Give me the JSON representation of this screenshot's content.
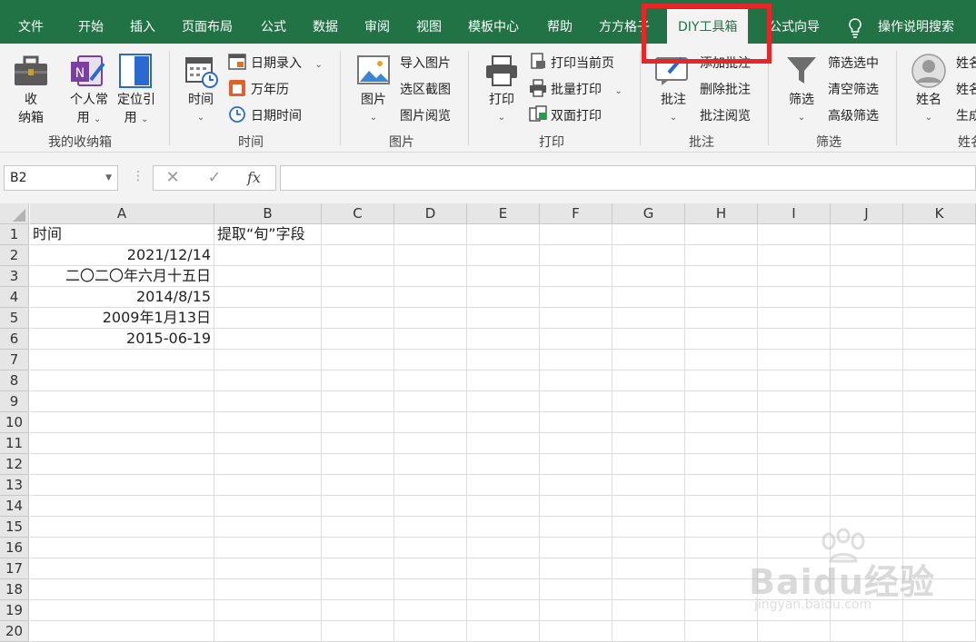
{
  "menubar": {
    "tabs": [
      "文件",
      "开始",
      "插入",
      "页面布局",
      "公式",
      "数据",
      "审阅",
      "视图",
      "模板中心",
      "帮助",
      "方方格子",
      "DIY工具箱",
      "公式向导",
      "操作说明搜索"
    ],
    "active_tab": "DIY工具箱"
  },
  "ribbon": {
    "collect": {
      "label_line1": "收",
      "label_line2": "纳箱",
      "personal_line1": "个人常",
      "personal_line2": "用",
      "locate_line1": "定位引",
      "locate_line2": "用",
      "group": "我的收纳箱"
    },
    "time": {
      "big": "时间",
      "date_entry": "日期录入",
      "calendar": "万年历",
      "datetime": "日期时间",
      "group": "时间"
    },
    "picture": {
      "big": "图片",
      "import": "导入图片",
      "screenshot": "选区截图",
      "browse": "图片阅览",
      "group": "图片"
    },
    "print": {
      "big": "打印",
      "current": "打印当前页",
      "batch": "批量打印",
      "duplex": "双面打印",
      "group": "打印"
    },
    "comment": {
      "big": "批注",
      "add": "添加批注",
      "delete": "删除批注",
      "browse": "批注阅览",
      "group": "批注"
    },
    "filter": {
      "big": "筛选",
      "select": "筛选选中",
      "clear": "清空筛选",
      "advanced": "高级筛选",
      "group": "筛选"
    },
    "name": {
      "big": "姓名",
      "item1": "姓名",
      "item2": "姓名",
      "item3": "生成",
      "group": "姓名"
    }
  },
  "formula_bar": {
    "name_box": "B2",
    "cancel": "✕",
    "enter": "✓",
    "fx": "fx",
    "value": ""
  },
  "sheet": {
    "columns": [
      "A",
      "B",
      "C",
      "D",
      "E",
      "F",
      "G",
      "H",
      "I",
      "J",
      "K"
    ],
    "rows": [
      "1",
      "2",
      "3",
      "4",
      "5",
      "6",
      "7",
      "8",
      "9",
      "10",
      "11",
      "12",
      "13",
      "14",
      "15",
      "16",
      "17",
      "18",
      "19",
      "20"
    ],
    "cells": {
      "A1": "时间",
      "B1": "提取“旬”字段",
      "A2": "2021/12/14",
      "A3": "二〇二〇年六月十五日",
      "A4": "2014/8/15",
      "A5": "2009年1月13日",
      "A6": "2015-06-19"
    }
  },
  "watermark": {
    "brand": "Baidu经验",
    "url": "jingyan.baidu.com"
  },
  "colors": {
    "excel_green": "#217346",
    "highlight_red": "#e8262a",
    "ribbon_bg": "#f3f3f3"
  }
}
